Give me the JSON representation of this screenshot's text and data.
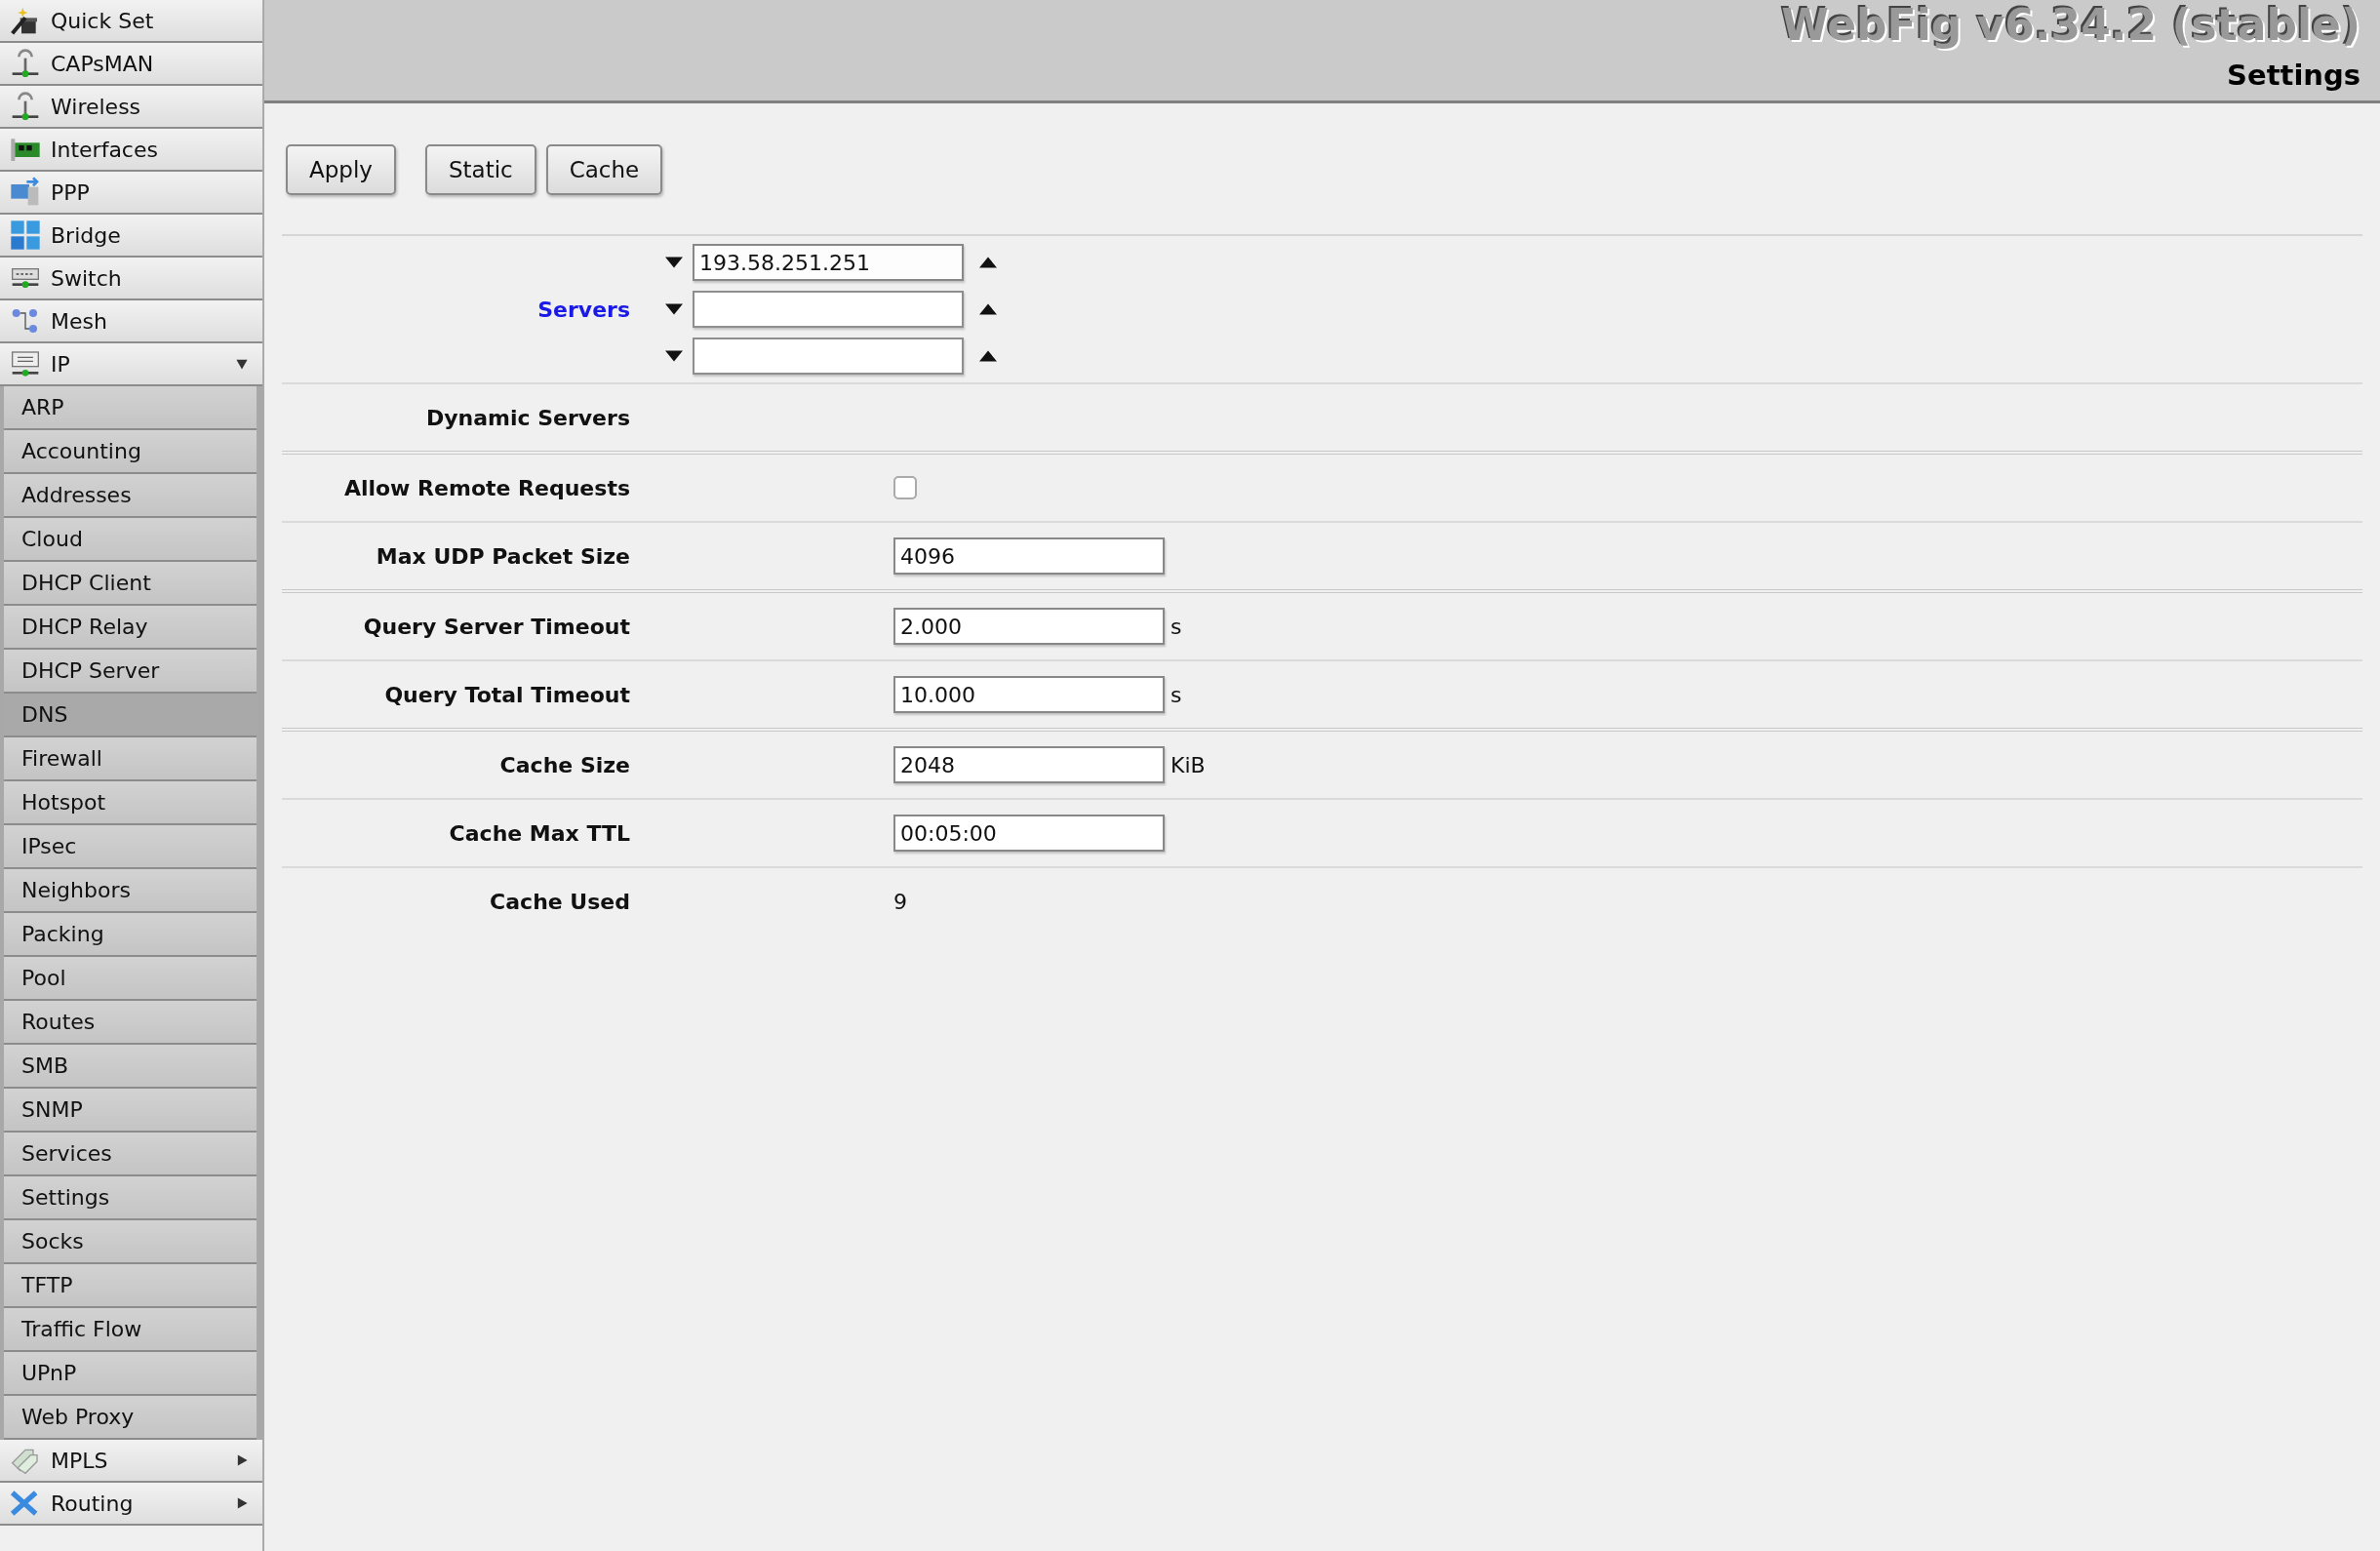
{
  "header": {
    "title": "WebFig v6.34.2 (stable)",
    "subtitle": "Settings"
  },
  "sidebar": {
    "items": [
      {
        "label": "Quick Set",
        "kind": "link"
      },
      {
        "label": "CAPsMAN",
        "kind": "link"
      },
      {
        "label": "Wireless",
        "kind": "link"
      },
      {
        "label": "Interfaces",
        "kind": "link"
      },
      {
        "label": "PPP",
        "kind": "link"
      },
      {
        "label": "Bridge",
        "kind": "link"
      },
      {
        "label": "Switch",
        "kind": "link"
      },
      {
        "label": "Mesh",
        "kind": "link"
      },
      {
        "label": "IP",
        "kind": "group",
        "expanded": true,
        "children": [
          {
            "label": "ARP",
            "selected": false
          },
          {
            "label": "Accounting",
            "selected": false
          },
          {
            "label": "Addresses",
            "selected": false
          },
          {
            "label": "Cloud",
            "selected": false
          },
          {
            "label": "DHCP Client",
            "selected": false
          },
          {
            "label": "DHCP Relay",
            "selected": false
          },
          {
            "label": "DHCP Server",
            "selected": false
          },
          {
            "label": "DNS",
            "selected": true
          },
          {
            "label": "Firewall",
            "selected": false
          },
          {
            "label": "Hotspot",
            "selected": false
          },
          {
            "label": "IPsec",
            "selected": false
          },
          {
            "label": "Neighbors",
            "selected": false
          },
          {
            "label": "Packing",
            "selected": false
          },
          {
            "label": "Pool",
            "selected": false
          },
          {
            "label": "Routes",
            "selected": false
          },
          {
            "label": "SMB",
            "selected": false
          },
          {
            "label": "SNMP",
            "selected": false
          },
          {
            "label": "Services",
            "selected": false
          },
          {
            "label": "Settings",
            "selected": false
          },
          {
            "label": "Socks",
            "selected": false
          },
          {
            "label": "TFTP",
            "selected": false
          },
          {
            "label": "Traffic Flow",
            "selected": false
          },
          {
            "label": "UPnP",
            "selected": false
          },
          {
            "label": "Web Proxy",
            "selected": false
          }
        ]
      },
      {
        "label": "MPLS",
        "kind": "group",
        "expanded": false
      },
      {
        "label": "Routing",
        "kind": "group",
        "expanded": false
      }
    ]
  },
  "buttons": [
    [
      "Apply"
    ],
    [
      "Static",
      "Cache"
    ]
  ],
  "form": {
    "groups": [
      [
        {
          "kind": "multi",
          "label": "Servers",
          "inputs": [
            {
              "kind": "filled",
              "value": "193.58.251.251"
            },
            {
              "kind": "blank"
            },
            {
              "kind": "blank"
            }
          ]
        },
        {
          "kind": "text",
          "label": "Dynamic Servers"
        }
      ],
      [
        {
          "kind": "checkbox",
          "label": "Allow Remote Requests",
          "checked": false
        },
        {
          "kind": "field",
          "label": "Max UDP Packet Size",
          "value": "4096"
        }
      ],
      [
        {
          "kind": "field",
          "label": "Query Server Timeout",
          "value": "2.000",
          "unit": "s"
        },
        {
          "kind": "field",
          "label": "Query Total Timeout",
          "value": "10.000",
          "unit": "s"
        }
      ],
      [
        {
          "kind": "field",
          "label": "Cache Size",
          "value": "2048",
          "unit": "KiB"
        },
        {
          "kind": "field",
          "label": "Cache Max TTL",
          "value": "00:05:00"
        },
        {
          "kind": "text",
          "label": "Cache Used",
          "value": "9"
        }
      ]
    ]
  }
}
